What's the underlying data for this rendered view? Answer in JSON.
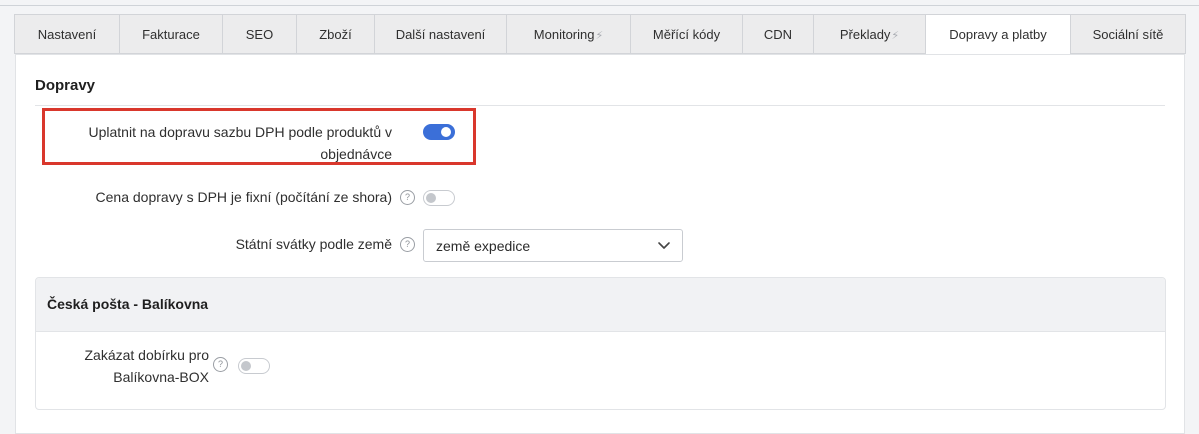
{
  "tabs": [
    {
      "label": "Nastavení",
      "bolt": false
    },
    {
      "label": "Fakturace",
      "bolt": false
    },
    {
      "label": "SEO",
      "bolt": false
    },
    {
      "label": "Zboží",
      "bolt": false
    },
    {
      "label": "Další nastavení",
      "bolt": false
    },
    {
      "label": "Monitoring",
      "bolt": true
    },
    {
      "label": "Měřící kódy",
      "bolt": false
    },
    {
      "label": "CDN",
      "bolt": false
    },
    {
      "label": "Překlady",
      "bolt": true
    },
    {
      "label": "Dopravy a platby",
      "bolt": false,
      "active": true
    },
    {
      "label": "Sociální sítě",
      "bolt": false
    }
  ],
  "dopravy": {
    "title": "Dopravy",
    "vat_setting": {
      "label_line1": "Uplatnit na dopravu sazbu DPH podle produktů v",
      "label_line2": "objednávce",
      "enabled": true
    },
    "fixed_price": {
      "label": "Cena dopravy s DPH je fixní (počítání ze shora)",
      "help": "?",
      "enabled": false
    },
    "holidays": {
      "label": "Státní svátky podle země",
      "help": "?",
      "value": "země expedice"
    }
  },
  "carrier": {
    "title": "Česká pošta - Balíkovna",
    "disable_cod": {
      "label_line1": "Zakázat dobírku pro",
      "label_line2": "Balíkovna-BOX",
      "help": "?",
      "enabled": false
    }
  },
  "icons": {
    "bolt": "⚡",
    "help": "question-circle-icon",
    "chevron": "chevron-down-icon"
  },
  "colors": {
    "toggle_on": "#3b6fd8",
    "highlight": "#d9372c"
  }
}
